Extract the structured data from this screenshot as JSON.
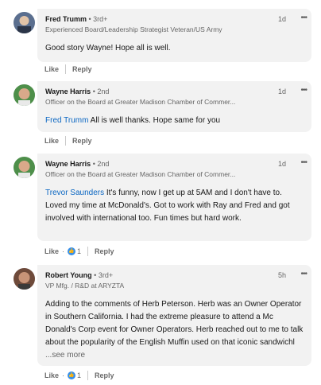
{
  "comments": [
    {
      "name": "Fred Trumm",
      "degree": " • 3rd+",
      "headline": "Experienced Board/Leadership Strategist Veteran/US Army",
      "time": "1d",
      "mention": "",
      "text": "Good story Wayne! Hope all is well.",
      "like_label": "Like",
      "reply_label": "Reply",
      "reactions": ""
    },
    {
      "name": "Wayne Harris",
      "degree": " • 2nd",
      "headline": "Officer on the Board at Greater Madison Chamber of Commer...",
      "time": "1d",
      "mention": "Fred Trumm",
      "text": " All is well thanks. Hope same for you",
      "like_label": "Like",
      "reply_label": "Reply",
      "reactions": ""
    },
    {
      "name": "Wayne Harris",
      "degree": " • 2nd",
      "headline": "Officer on the Board at Greater Madison Chamber of Commer...",
      "time": "1d",
      "mention": "Trevor Saunders",
      "text": " It's funny, now I get up at 5AM and I don't have to. Loved my time at McDonald's. Got to work with Ray and Fred and got involved with international too. Fun times but hard work.",
      "like_label": "Like",
      "reply_label": "Reply",
      "reactions": "1"
    },
    {
      "name": "Robert Young",
      "degree": " • 3rd+",
      "headline": "VP Mfg. / R&D at ARYZTA",
      "time": "5h",
      "mention": "",
      "text": "Adding to the comments of Herb Peterson. Herb was an Owner Operator in Southern California. I had the extreme pleasure to attend a Mc Donald's Corp event for Owner Operators. Herb reached out to me to talk about the popularity of the English Muffin used on that iconic sandwichl",
      "see_more": "...see more",
      "like_label": "Like",
      "reply_label": "Reply",
      "reactions": "1"
    }
  ],
  "more_glyph": "•••",
  "dot_sep": "·"
}
